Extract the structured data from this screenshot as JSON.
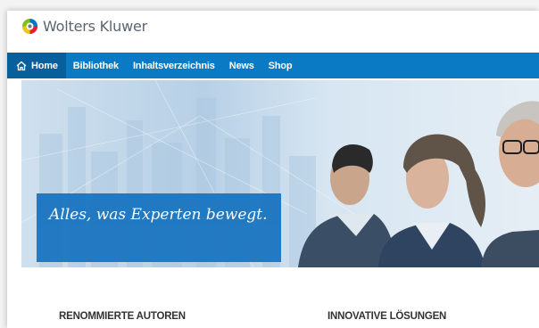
{
  "brand": {
    "name": "Wolters Kluwer"
  },
  "nav": {
    "items": [
      {
        "label": "Home",
        "active": true
      },
      {
        "label": "Bibliothek",
        "active": false
      },
      {
        "label": "Inhaltsverzeichnis",
        "active": false
      },
      {
        "label": "News",
        "active": false
      },
      {
        "label": "Shop",
        "active": false
      }
    ]
  },
  "hero": {
    "tagline": "Alles, was Experten bewegt."
  },
  "sections": {
    "left_heading": "RENOMMIERTE AUTOREN",
    "right_heading": "INNOVATIVE LÖSUNGEN"
  },
  "colors": {
    "nav_bg": "#0a7ac4",
    "nav_active_bg": "#075f9c",
    "hero_box": "#1a75c0"
  },
  "icons": [
    "wolters-kluwer-logo-icon",
    "home-icon"
  ]
}
